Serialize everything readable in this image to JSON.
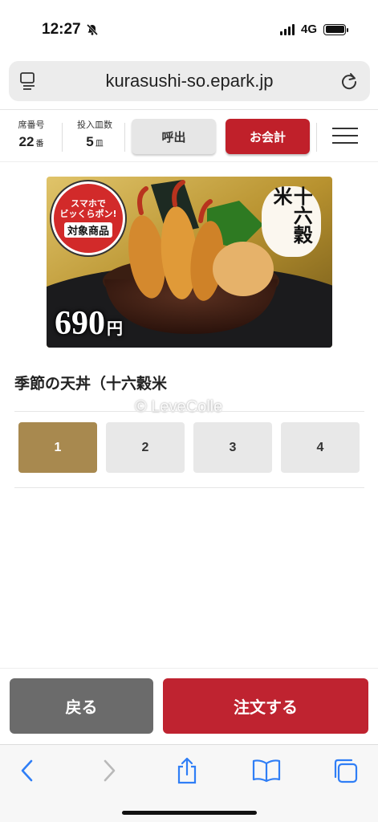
{
  "status_bar": {
    "time": "12:27",
    "network": "4G",
    "battery_percent": 90
  },
  "browser": {
    "url": "kurasushi-so.epark.jp"
  },
  "header": {
    "seat_label": "席番号",
    "seat_number": "22",
    "seat_unit": "番",
    "plates_label": "投入皿数",
    "plates_count": "5",
    "plates_unit": "皿",
    "call_button": "呼出",
    "checkout_button": "お会計"
  },
  "hero": {
    "badge_line1": "スマホで",
    "badge_line2": "ビッくらポン!",
    "badge_line3": "対象商品",
    "seal_text": "十六穀米",
    "price": "690",
    "price_unit": "円"
  },
  "item": {
    "name": "季節の天丼（十六穀米"
  },
  "watermark": "© LeveColle",
  "quantity": {
    "options": [
      "1",
      "2",
      "3",
      "4"
    ],
    "selected": "1"
  },
  "actions": {
    "back_button": "戻る",
    "order_button": "注文する"
  },
  "colors": {
    "checkout_red": "#c0202a",
    "order_red": "#bf2330",
    "selected_gold": "#a8894f",
    "back_gray": "#6b6b6b",
    "ios_blue": "#2f7ef6"
  }
}
